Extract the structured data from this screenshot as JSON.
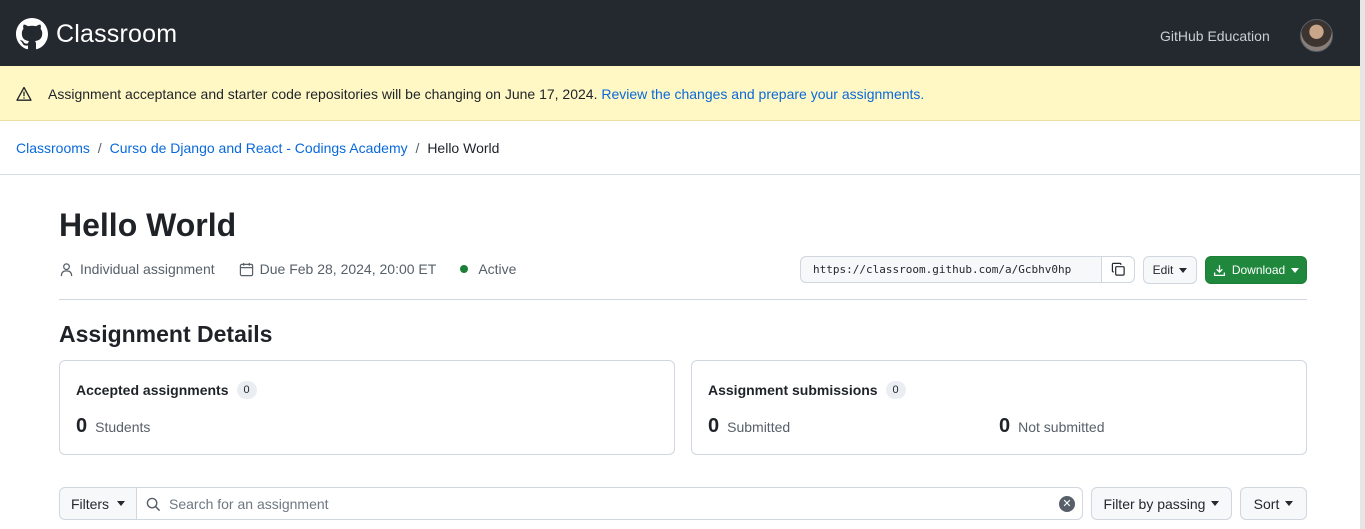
{
  "header": {
    "brand": "Classroom",
    "github_education": "GitHub Education",
    "logo_icon": "github-octocat-icon",
    "avatar_icon": "user-avatar"
  },
  "banner": {
    "icon": "alert-triangle-icon",
    "text": "Assignment acceptance and starter code repositories will be changing on June 17, 2024.",
    "link": "Review the changes and prepare your assignments."
  },
  "breadcrumb": {
    "items": [
      "Classrooms",
      "Curso de Django and React - Codings Academy"
    ],
    "separator": "/",
    "current": "Hello World"
  },
  "assignment": {
    "title": "Hello World",
    "type": "Individual assignment",
    "due": "Due Feb 28, 2024, 20:00 ET",
    "status": "Active",
    "status_color": "#1a7f37",
    "invite_url": "https://classroom.github.com/a/Gcbhv0hp",
    "edit_label": "Edit",
    "download_label": "Download"
  },
  "details": {
    "heading": "Assignment Details",
    "accepted": {
      "label": "Accepted assignments",
      "count": "0",
      "students_num": "0",
      "students_label": "Students"
    },
    "submissions": {
      "label": "Assignment submissions",
      "count": "0",
      "submitted_num": "0",
      "submitted_label": "Submitted",
      "not_submitted_num": "0",
      "not_submitted_label": "Not submitted"
    }
  },
  "toolbar": {
    "filters_label": "Filters",
    "search_placeholder": "Search for an assignment",
    "filter_passing_label": "Filter by passing",
    "sort_label": "Sort"
  },
  "colors": {
    "header_bg": "#24292f",
    "banner_bg": "#fff8c5",
    "link": "#0969da",
    "primary_button": "#1f883d"
  }
}
